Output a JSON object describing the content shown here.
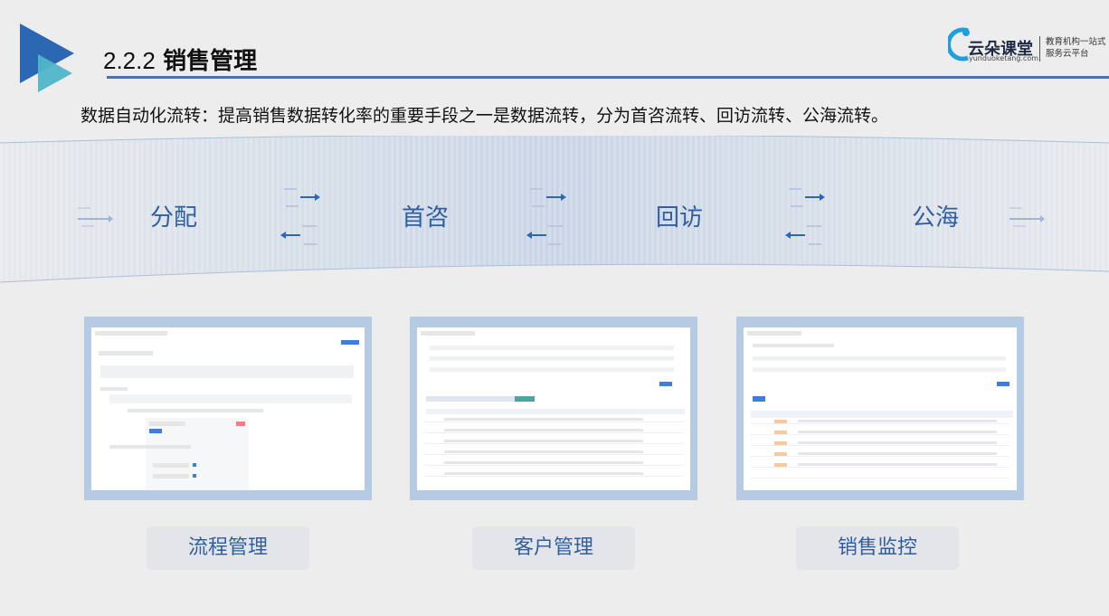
{
  "header": {
    "section_number": "2.2.2",
    "section_title": "销售管理",
    "logo_name": "云朵课堂",
    "logo_url": "yunduoketang.com",
    "logo_slogan": "教育机构一站式服务云平台"
  },
  "intro_text": "数据自动化流转：提高销售数据转化率的重要手段之一是数据流转，分为首咨流转、回访流转、公海流转。",
  "flow_stages": [
    "分配",
    "首咨",
    "回访",
    "公海"
  ],
  "modules": [
    {
      "label": "流程管理",
      "screenshot": "process-management-screenshot"
    },
    {
      "label": "客户管理",
      "screenshot": "customer-management-screenshot"
    },
    {
      "label": "销售监控",
      "screenshot": "sales-monitoring-screenshot"
    }
  ],
  "colors": {
    "accent_blue": "#2f5fa0",
    "header_rule": "#4a74a8",
    "play_icon_dark": "#2c67b3",
    "play_icon_teal": "#4fb6c8",
    "button_bg": "#e4e5e8",
    "screenshot_frame": "#b5cbe4"
  },
  "icons": [
    "play-logo-icon",
    "cloud-logo-icon",
    "flow-arrows-icon"
  ]
}
